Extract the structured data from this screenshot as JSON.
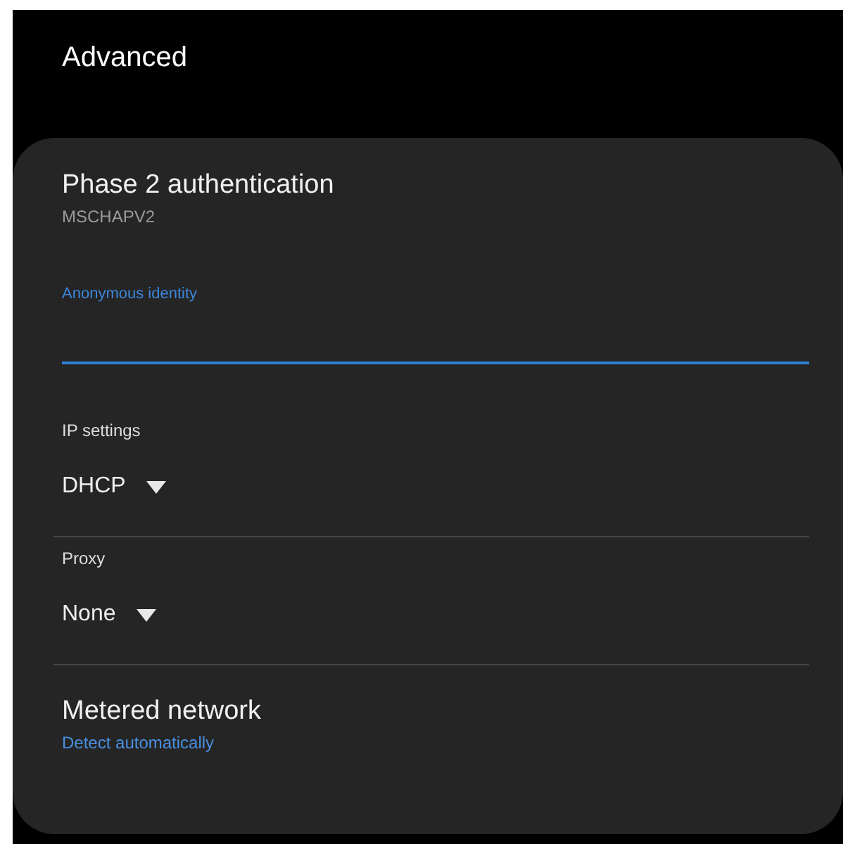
{
  "header": {
    "title": "Advanced"
  },
  "items": [
    {
      "kind": "preference",
      "title": "Phase 2 authentication",
      "summary": "MSCHAPV2",
      "summary_accent": false
    },
    {
      "kind": "text_field",
      "label": "Anonymous identity",
      "focused": true
    },
    {
      "kind": "dropdown",
      "label": "IP settings",
      "value": "DHCP"
    },
    {
      "kind": "dropdown",
      "label": "Proxy",
      "value": "None"
    },
    {
      "kind": "preference",
      "title": "Metered network",
      "summary": "Detect automatically",
      "summary_accent": true
    }
  ]
}
